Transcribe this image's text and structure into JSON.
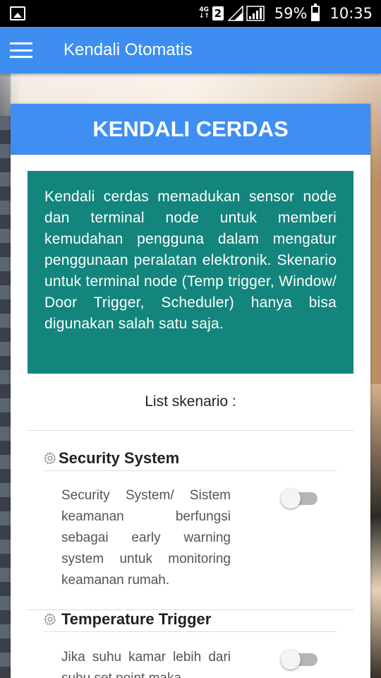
{
  "status_bar": {
    "network_type": "4G",
    "sim_slot": "2",
    "battery_percent": "59%",
    "time": "10:35"
  },
  "app_bar": {
    "title": "Kendali Otomatis",
    "menu_icon": "hamburger-menu-icon"
  },
  "card": {
    "header": "KENDALI CERDAS",
    "info_text": "Kendali cerdas memadukan sensor node dan terminal node untuk memberi kemudahan pengguna dalam mengatur penggunaan peralatan elektronik. Skenario untuk terminal node (Temp trigger, Window/ Door Trigger, Scheduler) hanya bisa digunakan salah satu saja.",
    "list_title": "List skenario :",
    "scenarios": [
      {
        "icon": "gear-icon",
        "title": "Security System",
        "description": "Security System/ Sistem keamanan berfungsi sebagai early warning system untuk monitoring keamanan rumah.",
        "enabled": false
      },
      {
        "icon": "gear-icon",
        "title": "Temperature Trigger",
        "description": "Jika suhu kamar lebih dari suhu set point maka",
        "enabled": false
      }
    ]
  },
  "colors": {
    "app_bar": "#3d8ef0",
    "card_header": "#3f8ff2",
    "info_box": "#13857c"
  }
}
